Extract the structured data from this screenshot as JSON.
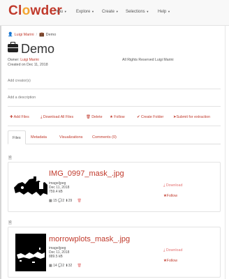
{
  "brand": {
    "name_pre": "Cl",
    "name_o": "o",
    "name_post": "wder"
  },
  "nav": {
    "items": [
      {
        "label": "You"
      },
      {
        "label": "Explore"
      },
      {
        "label": "Create"
      },
      {
        "label": "Selections"
      },
      {
        "label": "Help"
      }
    ]
  },
  "breadcrumb": {
    "user": "Luigi Marini",
    "current": "Demo"
  },
  "dataset": {
    "title": "Demo",
    "owner_label": "Owner:",
    "owner": "Luigi Marini",
    "created": "Created on Dec 11, 2018",
    "rights": "All Rights Reserved Luigi Marini",
    "add_creator": "Add creator(s)",
    "add_description": "Add a description"
  },
  "toolbar": {
    "add_files": "Add Files",
    "download_all": "Download All Files",
    "delete": "Delete",
    "follow": "Follow",
    "create_folder": "Create Folder",
    "submit": "Submit for extraction"
  },
  "tabs": [
    {
      "label": "Files"
    },
    {
      "label": "Metadata"
    },
    {
      "label": "Visualizations"
    },
    {
      "label": "Comments (0)"
    }
  ],
  "files": [
    {
      "name": "IMG_0997_mask_.jpg",
      "type": "image/jpeg",
      "date": "Dec 11, 2018",
      "size": "759.4 kB",
      "views": "15",
      "comments": "2",
      "downloads": "29",
      "download_label": "Download",
      "follow_label": "Follow"
    },
    {
      "name": "morrowplots_mask_.jpg",
      "type": "image/jpeg",
      "date": "Dec 11, 2018",
      "size": "889.5 kB",
      "views": "14",
      "comments": "2",
      "downloads": "32",
      "download_label": "Download",
      "follow_label": "Follow"
    }
  ]
}
